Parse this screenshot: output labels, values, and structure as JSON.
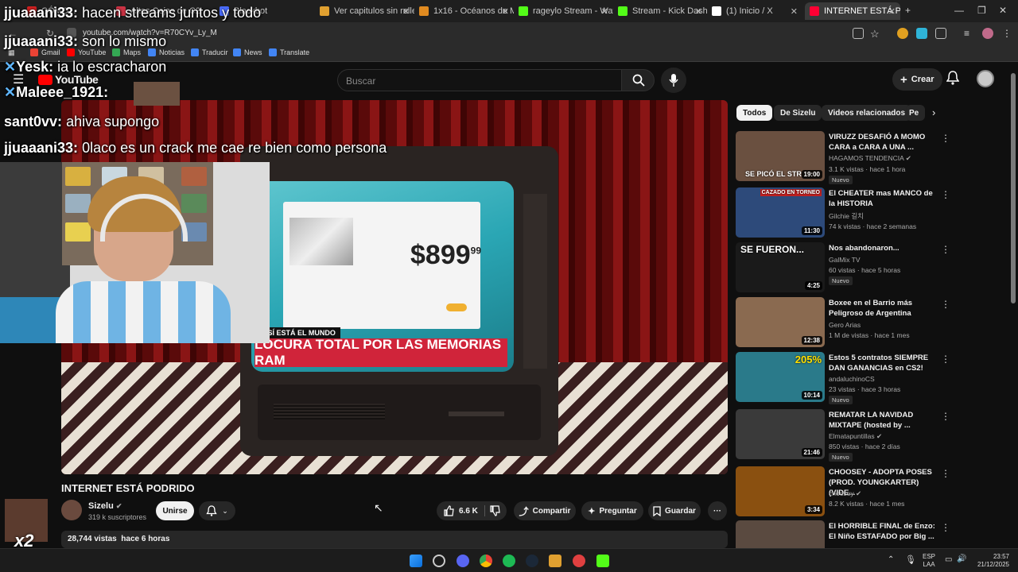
{
  "browser": {
    "tabs": [
      {
        "label": "CÓMO...",
        "color": "#d02020"
      },
      {
        "label": "Altos Cejas de C2",
        "color": "#cc3344"
      },
      {
        "label": "Blackbot",
        "color": "#4a6cff"
      },
      {
        "label": "Ver capitulos sin rellen",
        "color": "#e0a030"
      },
      {
        "label": "1x16 - Océanos de M",
        "color": "#e08a20"
      },
      {
        "label": "rageylo Stream - Wat",
        "color": "#53fc18"
      },
      {
        "label": "Stream - Kick Dashbo",
        "color": "#53fc18"
      },
      {
        "label": "(1) Inicio / X",
        "color": "#ffffff"
      },
      {
        "label": "INTERNET ESTÁ PODR",
        "color": "#ff0033"
      }
    ],
    "new_tab": "+",
    "url": "youtube.com/watch?v=R70CYv_Ly_M",
    "bookmarks": [
      "Gmail",
      "YouTube",
      "Maps",
      "Noticias",
      "Traducir",
      "News",
      "Translate"
    ]
  },
  "youtube": {
    "logo": "YouTube",
    "search_placeholder": "Buscar",
    "create_label": "Crear",
    "video": {
      "title": "INTERNET ESTÁ PODRIDO",
      "chyron_tag": "ASÍ ESTÁ EL MUNDO",
      "chyron": "LOCURA TOTAL POR LAS MEMORIAS RAM",
      "price": "$899",
      "price_cents": "99"
    },
    "channel": {
      "name": "Sizelu",
      "subs": "319 k suscriptores"
    },
    "join_label": "Unirse",
    "likes": "6.6 K",
    "share_label": "Compartir",
    "ask_label": "Preguntar",
    "save_label": "Guardar",
    "views": "28,744 vistas",
    "age": "hace 6 horas",
    "chips": [
      "Todos",
      "De Sizelu",
      "Videos relacionados",
      "Pe"
    ],
    "sidebar": [
      {
        "title": "VIRUZZ DESAFIÓ A MOMO CARA a CARA A UNA ...",
        "channel": "HAGAMOS TENDENCIA",
        "meta": "3.1 K vistas · hace 1 hora",
        "duration": "19:00",
        "new": "Nuevo",
        "thumb": "#6a5040",
        "thumbtext": "SE PICÓ EL STR"
      },
      {
        "title": "El CHEATER mas MANCO de la HISTORIA",
        "channel": "Gilchie 길치",
        "meta": "74 k vistas · hace 2 semanas",
        "duration": "11:30",
        "new": "",
        "thumb": "#2d4a7a",
        "thumbtext": "CAZADO EN TORNEO"
      },
      {
        "title": "Nos abandonaron...",
        "channel": "GalMix TV",
        "meta": "60 vistas · hace 5 horas",
        "duration": "4:25",
        "new": "Nuevo",
        "thumb": "#1a1a1a",
        "thumbtext": "SE FUERON..."
      },
      {
        "title": "Boxee en el Barrio más Peligroso de Argentina",
        "channel": "Gero Arias",
        "meta": "1 M de vistas · hace 1 mes",
        "duration": "12:38",
        "new": "",
        "thumb": "#8a6a50",
        "thumbtext": ""
      },
      {
        "title": "Estos 5 contratos SIEMPRE DAN GANANCIAS en CS2!",
        "channel": "andaluchinoCS",
        "meta": "23 vistas · hace 3 horas",
        "duration": "10:14",
        "new": "Nuevo",
        "thumb": "#2a7a8a",
        "thumbtext": "205%"
      },
      {
        "title": "REMATAR LA NAVIDAD MIXTAPE (hosted by ...",
        "channel": "Elmatapuntillas",
        "meta": "850 vistas · hace 2 días",
        "duration": "21:46",
        "new": "Nuevo",
        "thumb": "#3a3a3a",
        "thumbtext": ""
      },
      {
        "title": "CHOOSEY - ADOPTA POSES (PROD. YOUNGKARTER) (VIDE...",
        "channel": "choosey",
        "meta": "8.2 K vistas · hace 1 mes",
        "duration": "3:34",
        "new": "",
        "thumb": "#8a5010",
        "thumbtext": ""
      },
      {
        "title": "El HORRIBLE FINAL de Enzo: El Niño ESTAFADO por Big ...",
        "channel": "",
        "meta": "",
        "duration": "",
        "new": "",
        "thumb": "#5a4a40",
        "thumbtext": ""
      }
    ]
  },
  "chat": [
    {
      "user": "jjuaaani33:",
      "msg": "hacen streams juntos y todo"
    },
    {
      "user": "jjuaaani33:",
      "msg": "son lo mismo"
    },
    {
      "user": "Yesk:",
      "msg": "ia lo escracharon"
    },
    {
      "user": "Maleee_1921:",
      "msg": ""
    },
    {
      "user": "sant0vv:",
      "msg": "ahiva supongo"
    },
    {
      "user": "jjuaaani33:",
      "msg": "0laco es un crack me cae re bien como persona"
    }
  ],
  "overlay": {
    "multiplier": "x2"
  },
  "taskbar": {
    "lang1": "ESP",
    "lang2": "LAA",
    "time": "23:57",
    "date": "21/12/2025"
  }
}
